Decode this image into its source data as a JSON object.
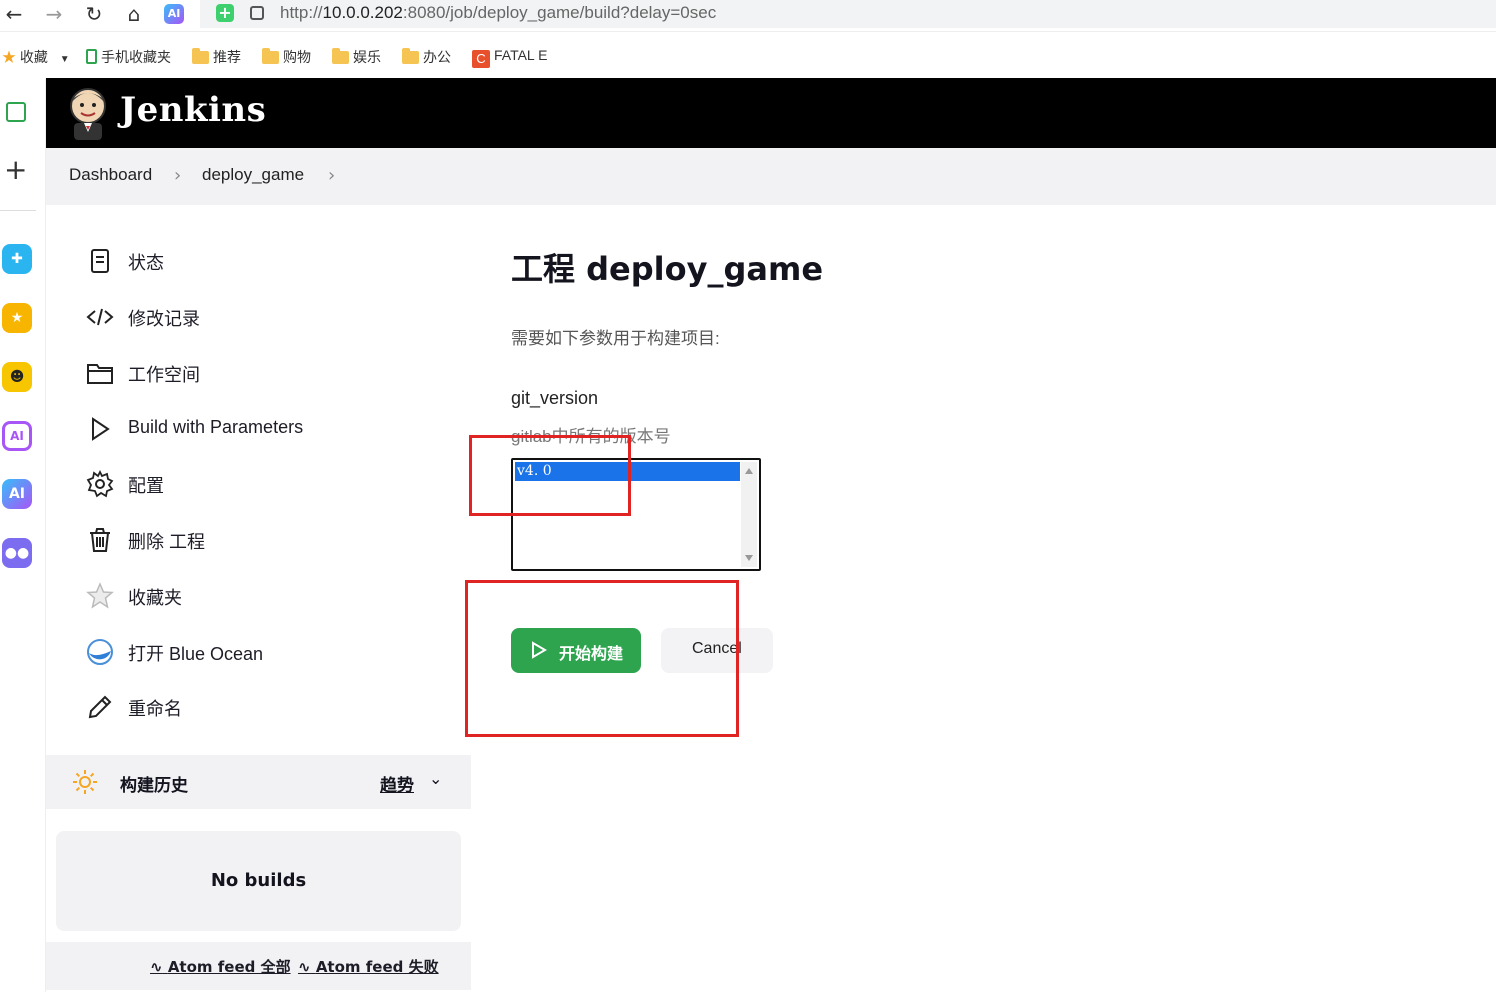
{
  "browser": {
    "url_prefix": "http://",
    "url_host": "10.0.0.202",
    "url_rest": ":8080/job/deploy_game/build?delay=0sec",
    "ai_badge": "AI",
    "bookmarks": [
      {
        "label": "收藏"
      },
      {
        "label": "手机收藏夹"
      },
      {
        "label": "推荐"
      },
      {
        "label": "购物"
      },
      {
        "label": "娱乐"
      },
      {
        "label": "办公"
      },
      {
        "label": "FATAL E"
      }
    ],
    "rail_ai_badge": "AI"
  },
  "header": {
    "title": "Jenkins"
  },
  "breadcrumb": [
    "Dashboard",
    "deploy_game"
  ],
  "sidebar": {
    "items": [
      {
        "label": "状态",
        "icon": "status-icon"
      },
      {
        "label": "修改记录",
        "icon": "code-icon"
      },
      {
        "label": "工作空间",
        "icon": "folder-icon"
      },
      {
        "label": "Build with Parameters",
        "icon": "play-icon"
      },
      {
        "label": "配置",
        "icon": "gear-icon"
      },
      {
        "label": "删除 工程",
        "icon": "trash-icon"
      },
      {
        "label": "收藏夹",
        "icon": "star-icon"
      },
      {
        "label": "打开 Blue Ocean",
        "icon": "blue-ocean-icon"
      },
      {
        "label": "重命名",
        "icon": "pencil-icon"
      }
    ]
  },
  "history": {
    "title": "构建历史",
    "trend": "趋势",
    "empty": "No builds",
    "feed_all": "Atom feed 全部",
    "feed_failed": "Atom feed 失败"
  },
  "main": {
    "title": "工程 deploy_game",
    "description": "需要如下参数用于构建项目:",
    "param_name": "git_version",
    "param_help": "gitlab中所有的版本号",
    "options": [
      "v4. 0"
    ],
    "selected": "v4. 0",
    "build_button": "开始构建",
    "cancel_button": "Cancel"
  },
  "colors": {
    "accent_green": "#2ea44f",
    "selection_blue": "#1a73e8",
    "annotation_red": "#e02424",
    "header_black": "#000000"
  }
}
